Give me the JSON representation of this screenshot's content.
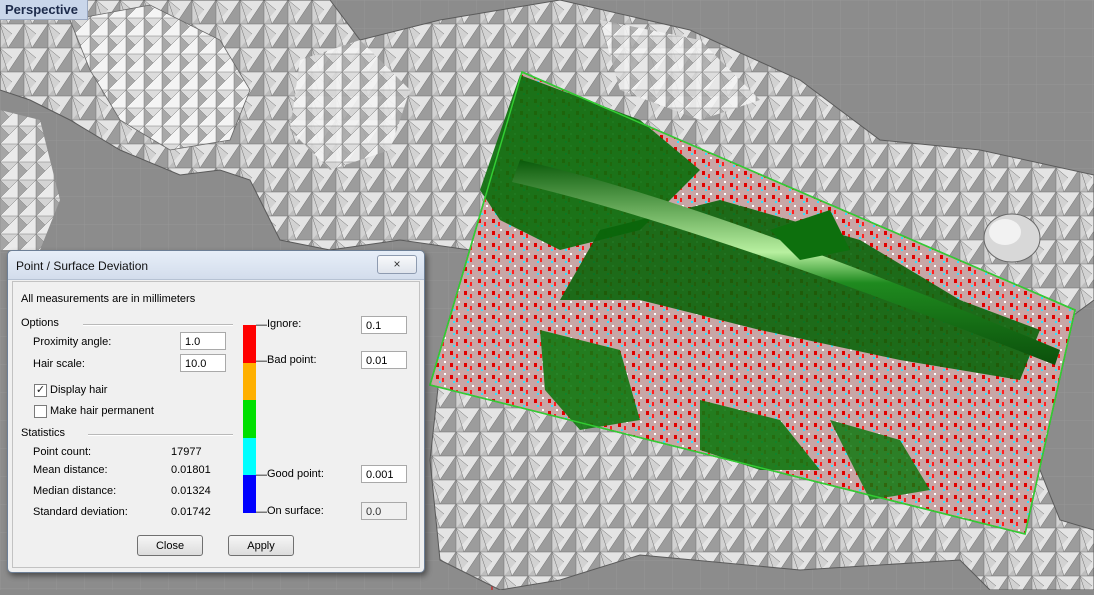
{
  "viewport": {
    "label": "Perspective"
  },
  "dialog": {
    "title": "Point / Surface Deviation",
    "close_icon": "×",
    "units_note": "All measurements are in millimeters",
    "options": {
      "header": "Options",
      "proximity_angle_label": "Proximity angle:",
      "proximity_angle_value": "1.0",
      "hair_scale_label": "Hair scale:",
      "hair_scale_value": "10.0",
      "display_hair_label": "Display hair",
      "display_hair_checked": true,
      "hair_permanent_label": "Make hair permanent",
      "hair_permanent_checked": false
    },
    "statistics": {
      "header": "Statistics",
      "rows": [
        {
          "label": "Point count:",
          "value": "17977"
        },
        {
          "label": "Mean distance:",
          "value": "0.01801"
        },
        {
          "label": "Median distance:",
          "value": "0.01324"
        },
        {
          "label": "Standard deviation:",
          "value": "0.01742"
        }
      ]
    },
    "thresholds": {
      "ignore_label": "Ignore:",
      "ignore_value": "0.1",
      "bad_label": "Bad point:",
      "bad_value": "0.01",
      "good_label": "Good point:",
      "good_value": "0.001",
      "on_surface_label": "On surface:",
      "on_surface_value": "0.0"
    },
    "color_scale": [
      "#ff0000",
      "#ffb000",
      "#00e000",
      "#00ffff",
      "#0000ff"
    ],
    "buttons": {
      "close": "Close",
      "apply": "Apply"
    }
  }
}
